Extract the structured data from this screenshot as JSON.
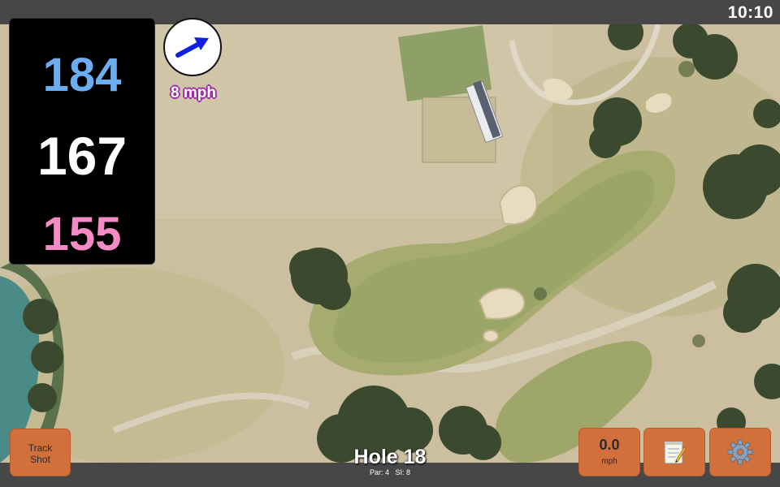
{
  "status": {
    "time": "10:10"
  },
  "distances": {
    "back": "184",
    "middle": "167",
    "front": "155"
  },
  "wind": {
    "speed": "8 mph",
    "arrow_color": "#1020e0"
  },
  "hole": {
    "title": "Hole 18",
    "par": "Par: 4",
    "stroke_index": "SI: 8"
  },
  "buttons": {
    "track_shot_line1": "Track",
    "track_shot_line2": "Shot",
    "speed_value": "0.0",
    "speed_unit": "mph",
    "notes_icon": "notepad-icon",
    "settings_icon": "gear-icon"
  },
  "colors": {
    "accent_orange": "#d2703c",
    "back_distance": "#6aaef0",
    "front_distance": "#f48bc4",
    "wind_text_outline": "#9b2fa0"
  }
}
